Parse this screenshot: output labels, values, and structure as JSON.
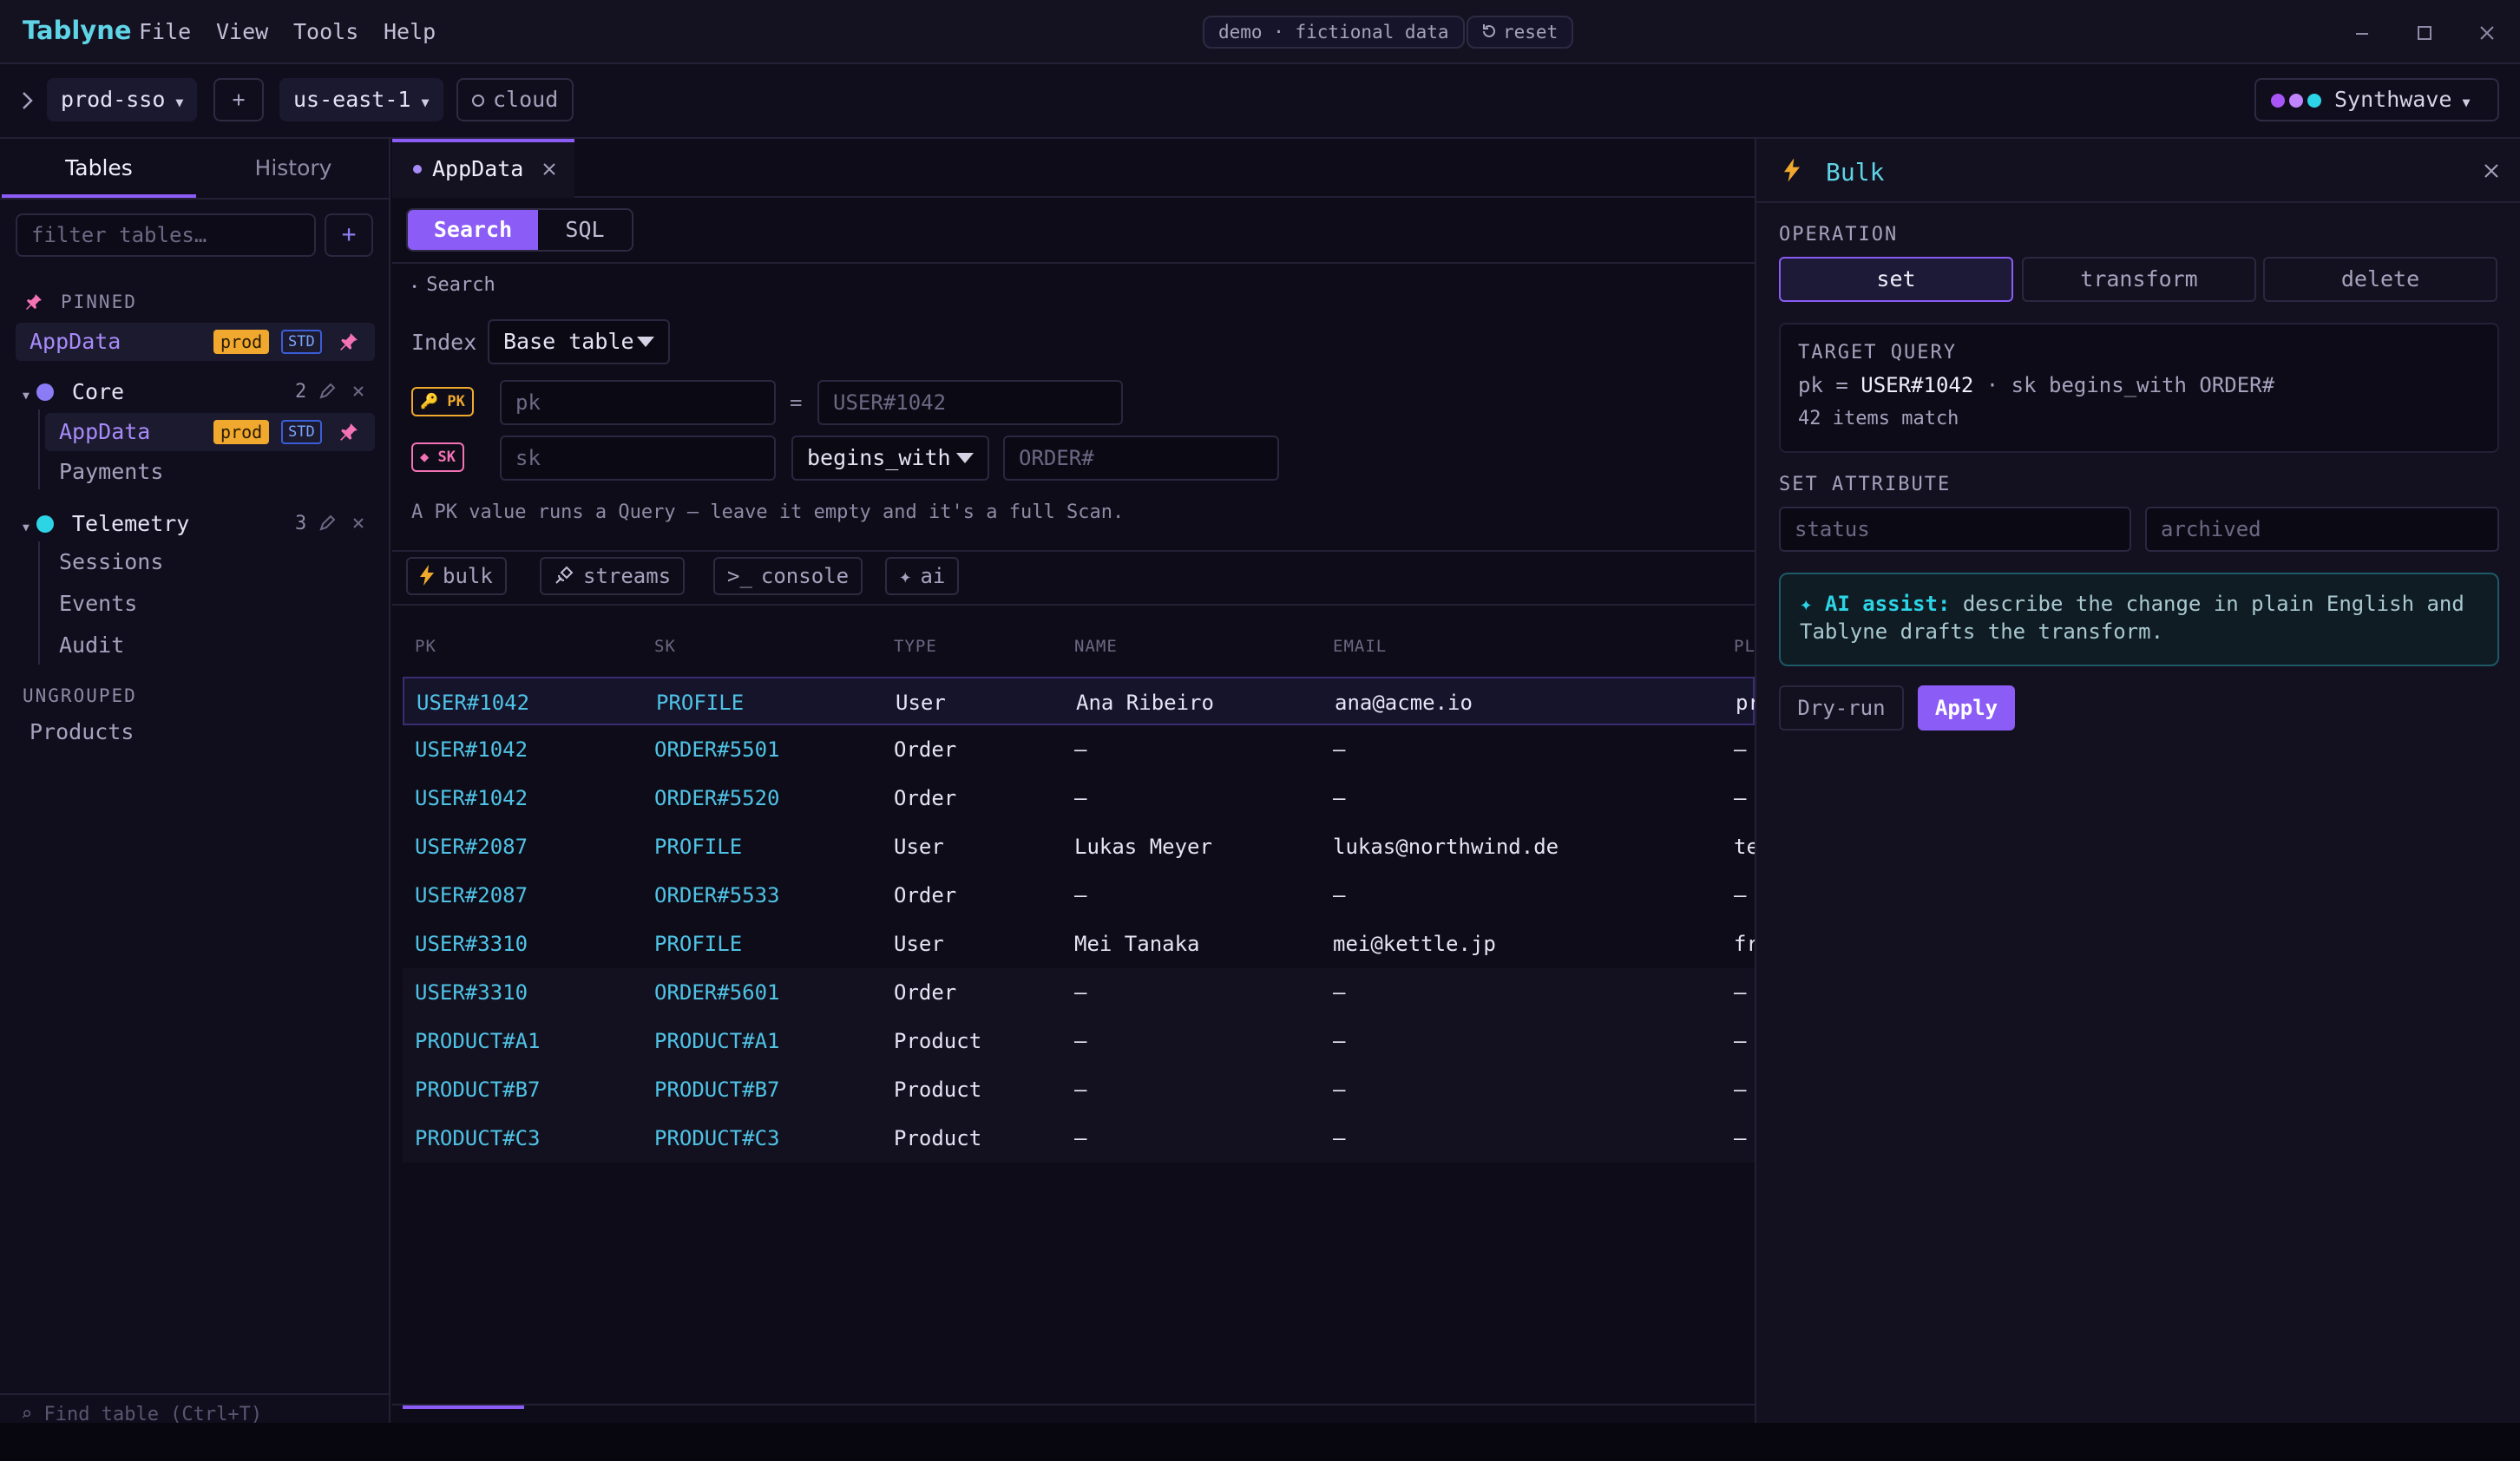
{
  "app": {
    "brand": "Tablyne",
    "menu": [
      "File",
      "View",
      "Tools",
      "Help"
    ],
    "demo_pill": "demo · fictional data",
    "reset_label": "reset"
  },
  "toolbar": {
    "profile": "prod-sso",
    "add_label": "+",
    "region": "us-east-1",
    "cloud_label": "cloud",
    "theme": "Synthwave"
  },
  "sidebar": {
    "tabs": [
      "Tables",
      "History"
    ],
    "filter_placeholder": "filter tables…",
    "add_label": "+",
    "pinned_label": "PINNED",
    "pinned_item": {
      "name": "AppData",
      "env": "prod",
      "class": "STD"
    },
    "groups": [
      {
        "name": "Core",
        "count": "2",
        "color": "#8b7cf6",
        "items": [
          {
            "name": "AppData",
            "env": "prod",
            "class": "STD",
            "selected": true
          },
          {
            "name": "Payments"
          }
        ]
      },
      {
        "name": "Telemetry",
        "count": "3",
        "color": "#2dd4e6",
        "items": [
          {
            "name": "Sessions"
          },
          {
            "name": "Events"
          },
          {
            "name": "Audit"
          }
        ]
      }
    ],
    "ungrouped_label": "UNGROUPED",
    "ungrouped": [
      "Products"
    ],
    "find_hint": "⌕ Find table (Ctrl+T)"
  },
  "main": {
    "tab_name": "AppData",
    "modes": [
      "Search",
      "SQL"
    ],
    "search_section": "Search",
    "index_label": "Index",
    "index_value": "Base table",
    "pk_badge": "PK",
    "pk_attr_placeholder": "pk",
    "pk_operator": "=",
    "pk_value_placeholder": "USER#1042",
    "sk_badge": "SK",
    "sk_attr_placeholder": "sk",
    "sk_operator": "begins_with",
    "sk_value_placeholder": "ORDER#",
    "hint": "A PK value runs a Query — leave it empty and it's a full Scan.",
    "actions": [
      {
        "icon": "bolt-icon",
        "label": "bulk"
      },
      {
        "icon": "satellite-icon",
        "label": "streams"
      },
      {
        "icon": "terminal-icon",
        "label": "console"
      },
      {
        "icon": "sparkle-icon",
        "label": "ai"
      }
    ]
  },
  "table": {
    "columns": [
      "PK",
      "SK",
      "TYPE",
      "NAME",
      "EMAIL",
      "PL"
    ],
    "rows": [
      [
        "USER#1042",
        "PROFILE",
        "User",
        "Ana Ribeiro",
        "ana@acme.io",
        "pr"
      ],
      [
        "USER#1042",
        "ORDER#5501",
        "Order",
        "—",
        "—",
        "—"
      ],
      [
        "USER#1042",
        "ORDER#5520",
        "Order",
        "—",
        "—",
        "—"
      ],
      [
        "USER#2087",
        "PROFILE",
        "User",
        "Lukas Meyer",
        "lukas@northwind.de",
        "te"
      ],
      [
        "USER#2087",
        "ORDER#5533",
        "Order",
        "—",
        "—",
        "—"
      ],
      [
        "USER#3310",
        "PROFILE",
        "User",
        "Mei Tanaka",
        "mei@kettle.jp",
        "fr"
      ],
      [
        "USER#3310",
        "ORDER#5601",
        "Order",
        "—",
        "—",
        "—"
      ],
      [
        "PRODUCT#A1",
        "PRODUCT#A1",
        "Product",
        "—",
        "—",
        "—"
      ],
      [
        "PRODUCT#B7",
        "PRODUCT#B7",
        "Product",
        "—",
        "—",
        "—"
      ],
      [
        "PRODUCT#C3",
        "PRODUCT#C3",
        "Product",
        "—",
        "—",
        "—"
      ]
    ]
  },
  "bulk": {
    "title": "Bulk",
    "operation_label": "OPERATION",
    "operations": [
      "set",
      "transform",
      "delete"
    ],
    "active_operation": "set",
    "target_label": "TARGET QUERY",
    "target_pk_key": "pk =",
    "target_pk_value": "USER#1042",
    "target_rest": "· sk begins_with ORDER#",
    "target_count": "42 items match",
    "set_label": "SET ATTRIBUTE",
    "attr_placeholder": "status",
    "value_placeholder": "archived",
    "ai_prefix": "✦ AI assist:",
    "ai_text": "describe the change in plain English and Tablyne drafts the transform.",
    "dry_run_label": "Dry-run",
    "apply_label": "Apply"
  },
  "colors": {
    "accent": "#8b5cf6",
    "key": "#4fc3e6",
    "prod_badge": "#f0a92e",
    "brand": "#5fd4e6"
  }
}
